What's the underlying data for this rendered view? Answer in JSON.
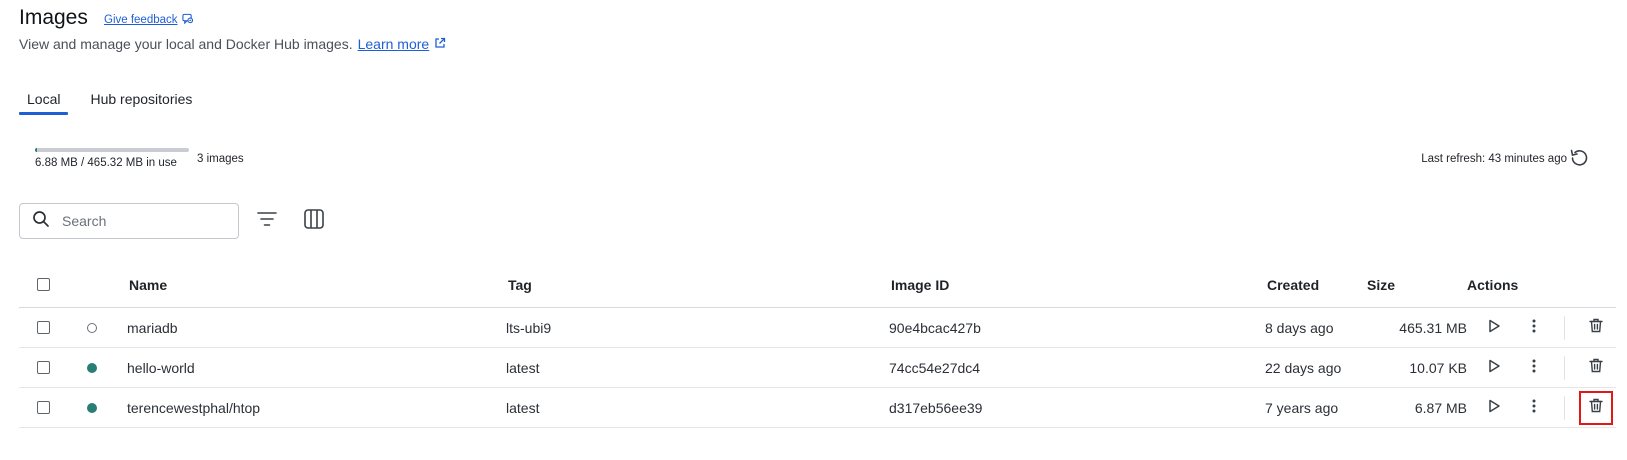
{
  "header": {
    "title": "Images",
    "feedback_label": "Give feedback",
    "subtitle": "View and manage your local and Docker Hub images.",
    "learn_more_label": "Learn more"
  },
  "tabs": [
    {
      "label": "Local",
      "active": true
    },
    {
      "label": "Hub repositories",
      "active": false
    }
  ],
  "usage": {
    "text": "6.88 MB / 465.32 MB in use",
    "fraction": 0.0148,
    "count_text": "3 images"
  },
  "refresh": {
    "text": "Last refresh: 43 minutes ago"
  },
  "search": {
    "placeholder": "Search",
    "value": ""
  },
  "table": {
    "columns": [
      "Name",
      "Tag",
      "Image ID",
      "Created",
      "Size",
      "Actions"
    ],
    "rows": [
      {
        "name": "mariadb",
        "tag": "lts-ubi9",
        "image_id": "90e4bcac427b",
        "created": "8 days ago",
        "size": "465.31 MB",
        "in_use": false
      },
      {
        "name": "hello-world",
        "tag": "latest",
        "image_id": "74cc54e27dc4",
        "created": "22 days ago",
        "size": "10.07 KB",
        "in_use": true
      },
      {
        "name": "terencewestphal/htop",
        "tag": "latest",
        "image_id": "d317eb56ee39",
        "created": "7 years ago",
        "size": "6.87 MB",
        "in_use": true
      }
    ]
  },
  "colors": {
    "accent": "#1f5fd6",
    "in_use": "#2a7d74",
    "highlight": "#e01919"
  },
  "icons": {
    "feedback": "feedback-icon",
    "external": "external-link-icon",
    "refresh": "refresh-icon",
    "search": "search-icon",
    "filter": "filter-icon",
    "columns": "columns-icon",
    "run": "play-icon",
    "more": "more-vertical-icon",
    "delete": "trash-icon"
  }
}
